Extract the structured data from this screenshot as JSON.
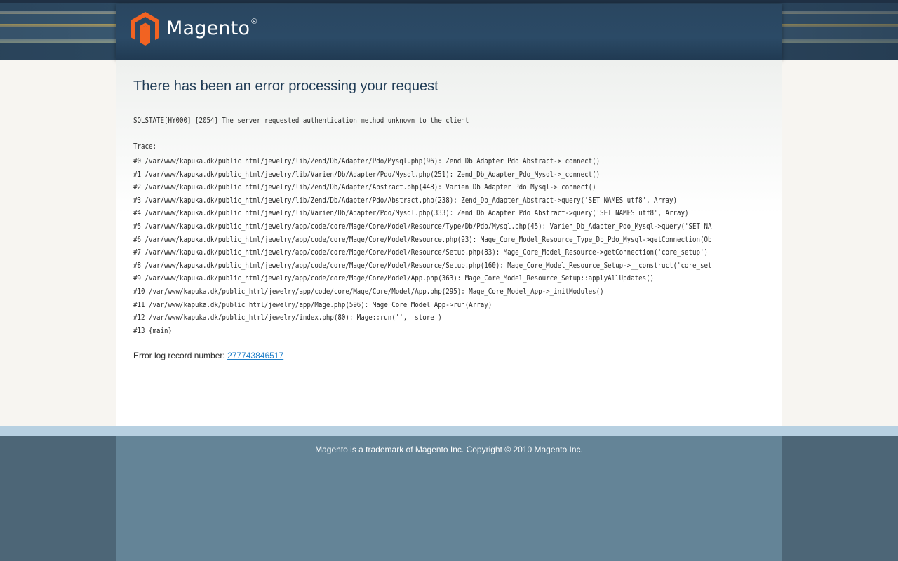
{
  "brand": {
    "name": "Magento",
    "registered_mark": "®"
  },
  "colors": {
    "header_dark": "#2a4660",
    "title": "#1f3b55",
    "link": "#1e7ec8",
    "footer_strip": "#b7d0e1",
    "footer": "#648497"
  },
  "main": {
    "title": "There has been an error processing your request",
    "error_message": "SQLSTATE[HY000] [2054] The server requested authentication method unknown to the client",
    "trace_label": "Trace:",
    "trace": [
      "#0 /var/www/kapuka.dk/public_html/jewelry/lib/Zend/Db/Adapter/Pdo/Mysql.php(96): Zend_Db_Adapter_Pdo_Abstract->_connect()",
      "#1 /var/www/kapuka.dk/public_html/jewelry/lib/Varien/Db/Adapter/Pdo/Mysql.php(251): Zend_Db_Adapter_Pdo_Mysql->_connect()",
      "#2 /var/www/kapuka.dk/public_html/jewelry/lib/Zend/Db/Adapter/Abstract.php(448): Varien_Db_Adapter_Pdo_Mysql->_connect()",
      "#3 /var/www/kapuka.dk/public_html/jewelry/lib/Zend/Db/Adapter/Pdo/Abstract.php(238): Zend_Db_Adapter_Abstract->query('SET NAMES utf8', Array)",
      "#4 /var/www/kapuka.dk/public_html/jewelry/lib/Varien/Db/Adapter/Pdo/Mysql.php(333): Zend_Db_Adapter_Pdo_Abstract->query('SET NAMES utf8', Array)",
      "#5 /var/www/kapuka.dk/public_html/jewelry/app/code/core/Mage/Core/Model/Resource/Type/Db/Pdo/Mysql.php(45): Varien_Db_Adapter_Pdo_Mysql->query('SET NA",
      "#6 /var/www/kapuka.dk/public_html/jewelry/app/code/core/Mage/Core/Model/Resource.php(93): Mage_Core_Model_Resource_Type_Db_Pdo_Mysql->getConnection(Ob",
      "#7 /var/www/kapuka.dk/public_html/jewelry/app/code/core/Mage/Core/Model/Resource/Setup.php(83): Mage_Core_Model_Resource->getConnection('core_setup')",
      "#8 /var/www/kapuka.dk/public_html/jewelry/app/code/core/Mage/Core/Model/Resource/Setup.php(160): Mage_Core_Model_Resource_Setup->__construct('core_set",
      "#9 /var/www/kapuka.dk/public_html/jewelry/app/code/core/Mage/Core/Model/App.php(363): Mage_Core_Model_Resource_Setup::applyAllUpdates()",
      "#10 /var/www/kapuka.dk/public_html/jewelry/app/code/core/Mage/Core/Model/App.php(295): Mage_Core_Model_App->_initModules()",
      "#11 /var/www/kapuka.dk/public_html/jewelry/app/Mage.php(596): Mage_Core_Model_App->run(Array)",
      "#12 /var/www/kapuka.dk/public_html/jewelry/index.php(80): Mage::run('', 'store')",
      "#13 {main}"
    ],
    "error_log_label": "Error log record number: ",
    "error_log_number": "277743846517"
  },
  "footer": {
    "copyright": "Magento is a trademark of Magento Inc. Copyright © 2010 Magento Inc."
  }
}
